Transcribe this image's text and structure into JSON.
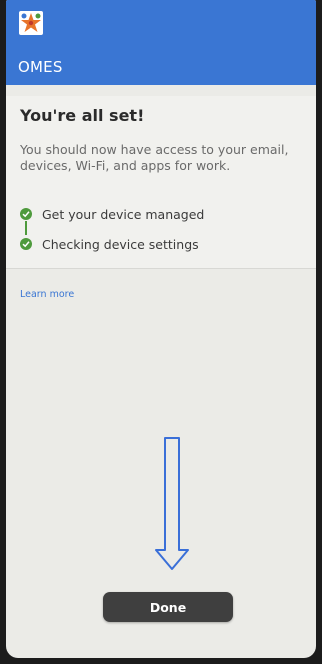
{
  "header": {
    "app_name": "OMES",
    "logo_icon": "omes-star-logo-icon",
    "color": "#3a76d3"
  },
  "content": {
    "heading": "You're all set!",
    "description": "You should now have access to your email, devices, Wi-Fi, and apps for work.",
    "steps": [
      {
        "label": "Get your device managed",
        "status": "complete",
        "icon": "check-circle-icon"
      },
      {
        "label": "Checking device settings",
        "status": "complete",
        "icon": "check-circle-icon"
      }
    ],
    "learn_more": "Learn more"
  },
  "footer": {
    "done_label": "Done"
  },
  "annotation": {
    "icon": "down-arrow-icon",
    "color": "#3a6fd8"
  },
  "colors": {
    "accent": "#3a76d3",
    "success": "#4e9a3c",
    "button": "#3f3f3f"
  }
}
